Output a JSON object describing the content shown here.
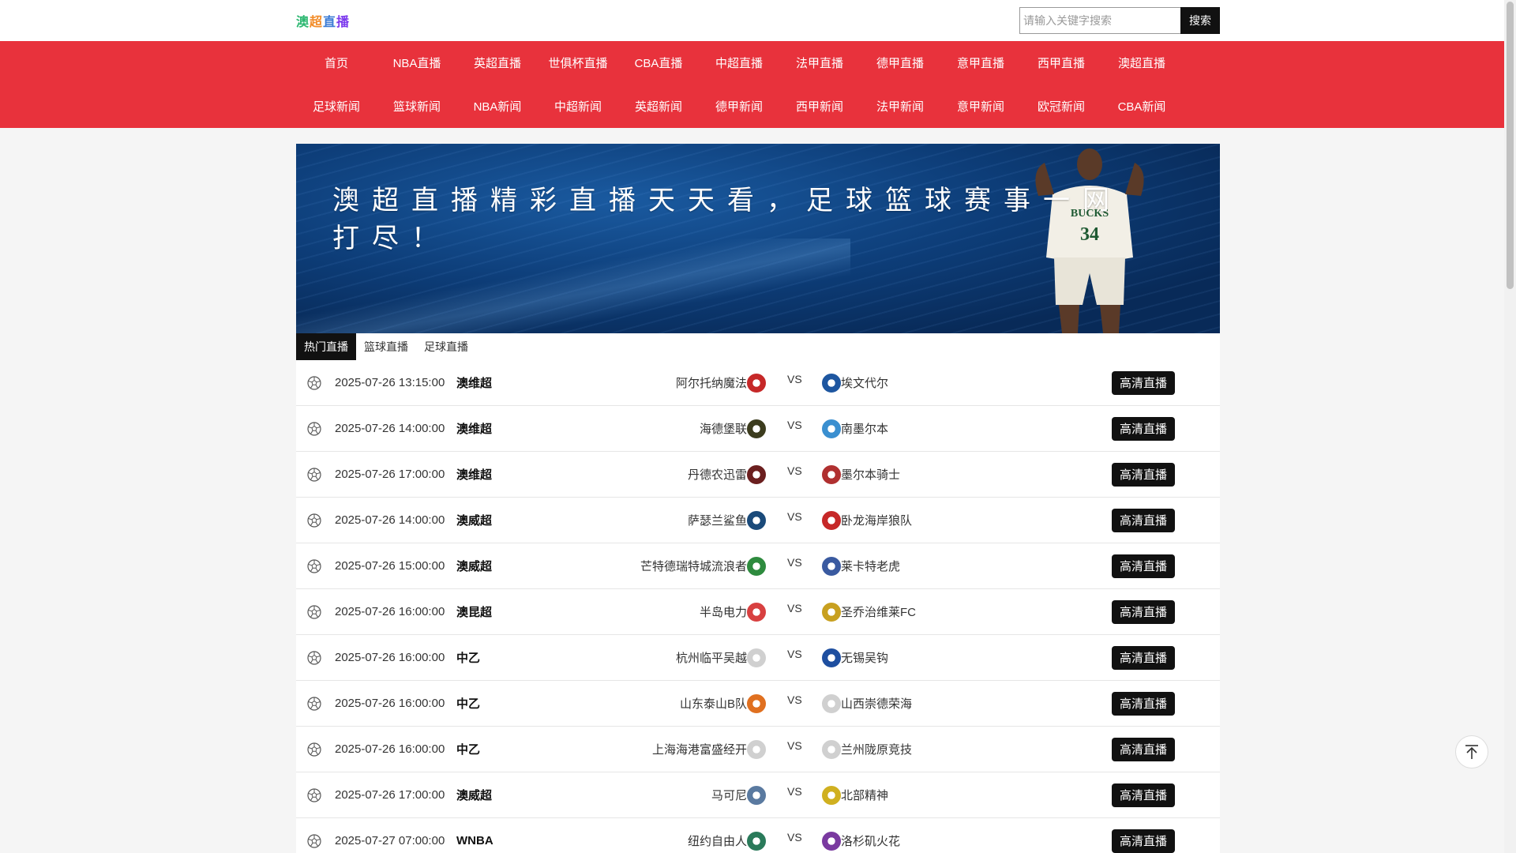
{
  "header": {
    "logo": "澳超直播",
    "search_placeholder": "请输入关键字搜索",
    "search_button": "搜索"
  },
  "nav": {
    "row1": [
      "首页",
      "NBA直播",
      "英超直播",
      "世俱杯直播",
      "CBA直播",
      "中超直播",
      "法甲直播",
      "德甲直播",
      "意甲直播",
      "西甲直播",
      "澳超直播"
    ],
    "row2": [
      "足球新闻",
      "篮球新闻",
      "NBA新闻",
      "中超新闻",
      "英超新闻",
      "德甲新闻",
      "西甲新闻",
      "法甲新闻",
      "意甲新闻",
      "欧冠新闻",
      "CBA新闻"
    ]
  },
  "banner": {
    "title": "澳超直播精彩直播天天看，足球篮球赛事一网打尽！"
  },
  "tabs": [
    {
      "label": "热门直播",
      "active": true
    },
    {
      "label": "篮球直播",
      "active": false
    },
    {
      "label": "足球直播",
      "active": false
    }
  ],
  "matches": [
    {
      "time": "2025-07-26 13:15:00",
      "league": "澳维超",
      "home": "阿尔托纳魔法",
      "away": "埃文代尔",
      "button": "高清直播",
      "home_color": "#c62828",
      "away_color": "#1e56a0"
    },
    {
      "time": "2025-07-26 14:00:00",
      "league": "澳维超",
      "home": "海德堡联",
      "away": "南墨尔本",
      "button": "高清直播",
      "home_color": "#3c3c1e",
      "away_color": "#3a8fd0"
    },
    {
      "time": "2025-07-26 17:00:00",
      "league": "澳维超",
      "home": "丹德农迅雷",
      "away": "墨尔本骑士",
      "button": "高清直播",
      "home_color": "#6b1f1f",
      "away_color": "#b03030"
    },
    {
      "time": "2025-07-26 14:00:00",
      "league": "澳威超",
      "home": "萨瑟兰鲨鱼",
      "away": "卧龙海岸狼队",
      "button": "高清直播",
      "home_color": "#1a4a7a",
      "away_color": "#c62828"
    },
    {
      "time": "2025-07-26 15:00:00",
      "league": "澳威超",
      "home": "芒特德瑞特城流浪者",
      "away": "莱卡特老虎",
      "button": "高清直播",
      "home_color": "#2e8b3e",
      "away_color": "#3a5aa0"
    },
    {
      "time": "2025-07-26 16:00:00",
      "league": "澳昆超",
      "home": "半岛电力",
      "away": "圣乔治维莱FC",
      "button": "高清直播",
      "home_color": "#d84040",
      "away_color": "#c8a020"
    },
    {
      "time": "2025-07-26 16:00:00",
      "league": "中乙",
      "home": "杭州临平吴越",
      "away": "无锡吴钩",
      "button": "高清直播",
      "home_color": "#d0d0d0",
      "away_color": "#1e4fa0"
    },
    {
      "time": "2025-07-26 16:00:00",
      "league": "中乙",
      "home": "山东泰山B队",
      "away": "山西崇德荣海",
      "button": "高清直播",
      "home_color": "#e07020",
      "away_color": "#d0d0d0"
    },
    {
      "time": "2025-07-26 16:00:00",
      "league": "中乙",
      "home": "上海海港富盛经开",
      "away": "兰州陇原竞技",
      "button": "高清直播",
      "home_color": "#d0d0d0",
      "away_color": "#d0d0d0"
    },
    {
      "time": "2025-07-26 17:00:00",
      "league": "澳威超",
      "home": "马可尼",
      "away": "北部精神",
      "button": "高清直播",
      "home_color": "#5a7aa0",
      "away_color": "#d0b020"
    },
    {
      "time": "2025-07-27 07:00:00",
      "league": "WNBA",
      "home": "纽约自由人",
      "away": "洛杉矶火花",
      "button": "高清直播",
      "home_color": "#2a7a5a",
      "away_color": "#7a3aa0"
    }
  ],
  "icons": {
    "sport": "soccer-ball-icon",
    "back_to_top": "arrow-up-icon"
  }
}
